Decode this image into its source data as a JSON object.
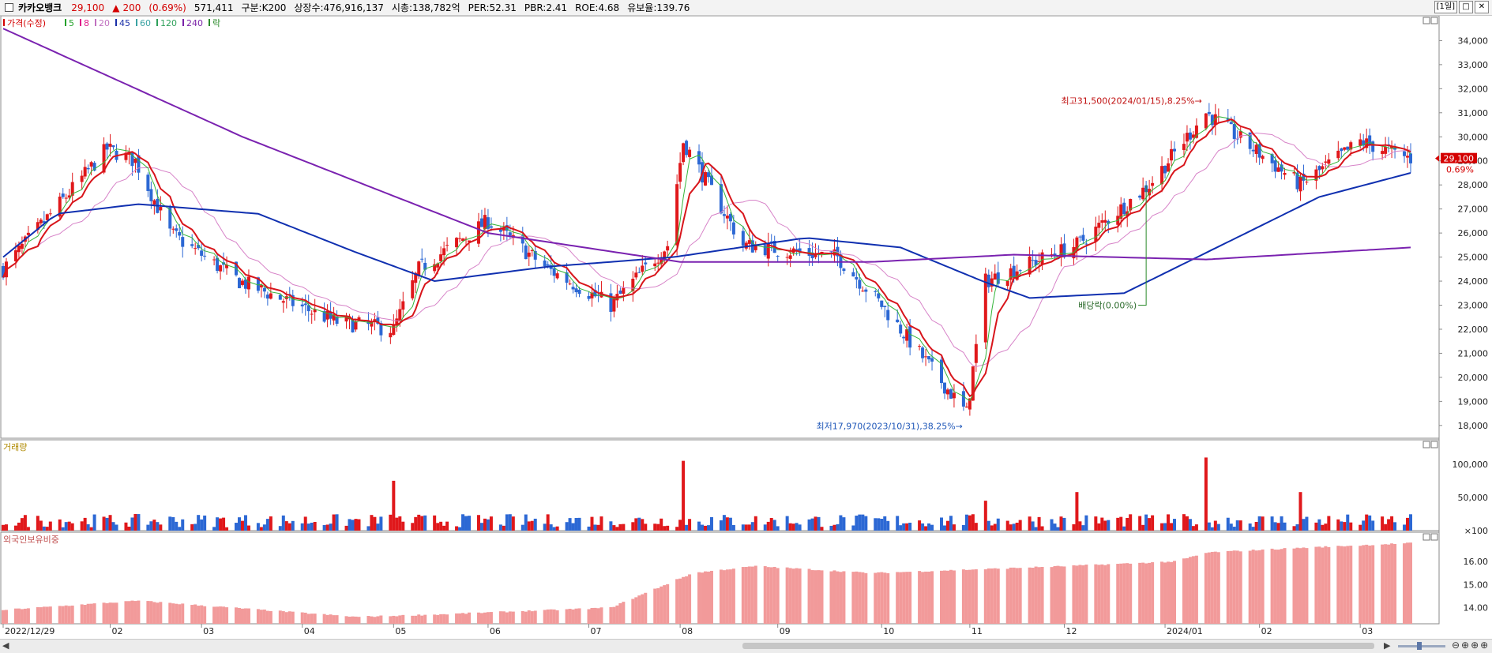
{
  "header": {
    "name": "카카오뱅크",
    "price": "29,100",
    "change_arrow": "▲",
    "change": "200",
    "change_pct": "(0.69%)",
    "volume": "571,411",
    "division": "구분:K200",
    "listed": "상장수:476,916,137",
    "market_cap": "시총:138,782억",
    "per": "PER:52.31",
    "pbr": "PBR:2.41",
    "roe": "ROE:4.68",
    "float": "유보율:139.76",
    "period_btn": "[1일]",
    "restore_btn": "□",
    "close_btn": "✕"
  },
  "legend": [
    {
      "label": "가격(수정)",
      "color": "#d40000"
    },
    {
      "label": "5",
      "color": "#24a12a"
    },
    {
      "label": "8",
      "color": "#e01b8a"
    },
    {
      "label": "20",
      "color": "#c070c0"
    },
    {
      "label": "45",
      "color": "#1a2fa8"
    },
    {
      "label": "60",
      "color": "#3aa3a3"
    },
    {
      "label": "120",
      "color": "#2ea05a"
    },
    {
      "label": "240",
      "color": "#7a22a8"
    },
    {
      "label": "락",
      "color": "#2a8a2a"
    }
  ],
  "colors": {
    "up": "#e0181b",
    "down": "#2c68d4",
    "foreign_bar": "#f29a9a",
    "ma5": "#35b53b",
    "ma8": "#d8151b",
    "ma20": "#d783c8",
    "ma45": "#1030b0",
    "ma120": "#3aa86a",
    "ma240": "#7a22b0"
  },
  "chart_data": [
    {
      "type": "candlestick",
      "title": "가격(수정)",
      "y_ticks": [
        "34,000",
        "33,000",
        "32,000",
        "31,000",
        "30,000",
        "29,000",
        "28,000",
        "27,000",
        "26,000",
        "25,000",
        "24,000",
        "23,000",
        "22,000",
        "21,000",
        "20,000",
        "19,000",
        "18,000"
      ],
      "ylim": [
        17600,
        34900
      ],
      "x_labels": [
        "2022/12/29",
        "02",
        "03",
        "04",
        "05",
        "06",
        "07",
        "08",
        "09",
        "10",
        "11",
        "12",
        "2024/01",
        "02",
        "03"
      ],
      "ohlc_anchors": [
        {
          "date": "2022/12/29",
          "close": 24500
        },
        {
          "date": "2023/01/31",
          "close": 29500
        },
        {
          "date": "2023/02/09",
          "close": 29000
        },
        {
          "date": "2023/02/20",
          "close": 26000
        },
        {
          "date": "2023/03/14",
          "close": 24000
        },
        {
          "date": "2023/04/14",
          "close": 22300
        },
        {
          "date": "2023/05/02",
          "close": 22000
        },
        {
          "date": "2023/05/10",
          "close": 24500
        },
        {
          "date": "2023/06/01",
          "close": 26500
        },
        {
          "date": "2023/06/20",
          "close": 24500
        },
        {
          "date": "2023/07/10",
          "close": 23000
        },
        {
          "date": "2023/07/28",
          "close": 25500
        },
        {
          "date": "2023/08/02",
          "close": 29800
        },
        {
          "date": "2023/08/21",
          "close": 25500
        },
        {
          "date": "2023/09/20",
          "close": 25000
        },
        {
          "date": "2023/10/04",
          "close": 23000
        },
        {
          "date": "2023/10/31",
          "close": 18500
        },
        {
          "date": "2023/11/06",
          "close": 24000
        },
        {
          "date": "2023/12/05",
          "close": 25500
        },
        {
          "date": "2023/12/28",
          "close": 28000
        },
        {
          "date": "2024/01/15",
          "close": 31000
        },
        {
          "date": "2024/02/14",
          "close": 28000
        },
        {
          "date": "2024/03/04",
          "close": 29800
        },
        {
          "date": "2024/03/20",
          "close": 29100
        }
      ],
      "annotations": [
        {
          "text": "최고31,500(2024/01/15),8.25%→",
          "date": "2024/01/15",
          "value": 31500
        },
        {
          "text": "최저17,970(2023/10/31),38.25%→",
          "date": "2023/10/31",
          "value": 17970
        },
        {
          "text": "배당락(0.00%)",
          "date": "2023/12/27",
          "value": 23000
        }
      ],
      "last_price_label": "29,100",
      "last_change_label": "0.69%",
      "moving_averages": {
        "ma240": [
          {
            "date": "2022/12/29",
            "value": 34500
          },
          {
            "date": "2023/03/15",
            "value": 30000
          },
          {
            "date": "2023/06/01",
            "value": 26000
          },
          {
            "date": "2023/08/01",
            "value": 24800
          },
          {
            "date": "2023/10/01",
            "value": 24800
          },
          {
            "date": "2023/11/15",
            "value": 25100
          },
          {
            "date": "2024/01/15",
            "value": 24900
          },
          {
            "date": "2024/03/20",
            "value": 25400
          }
        ],
        "ma45": [
          {
            "date": "2022/12/29",
            "value": 25000
          },
          {
            "date": "2023/01/15",
            "value": 26800
          },
          {
            "date": "2023/02/10",
            "value": 27200
          },
          {
            "date": "2023/03/20",
            "value": 26800
          },
          {
            "date": "2023/04/20",
            "value": 25200
          },
          {
            "date": "2023/05/15",
            "value": 24000
          },
          {
            "date": "2023/06/20",
            "value": 24600
          },
          {
            "date": "2023/07/30",
            "value": 25000
          },
          {
            "date": "2023/09/10",
            "value": 25800
          },
          {
            "date": "2023/10/10",
            "value": 25400
          },
          {
            "date": "2023/11/05",
            "value": 24000
          },
          {
            "date": "2023/11/20",
            "value": 23300
          },
          {
            "date": "2023/12/20",
            "value": 23500
          },
          {
            "date": "2024/01/20",
            "value": 25500
          },
          {
            "date": "2024/02/20",
            "value": 27500
          },
          {
            "date": "2024/03/20",
            "value": 28500
          }
        ]
      }
    },
    {
      "type": "bar",
      "title": "거래량",
      "y_ticks": [
        "100,000",
        "50,000",
        "×100"
      ],
      "peaks": [
        {
          "date": "2023/05/02",
          "value": 75000
        },
        {
          "date": "2023/08/02",
          "value": 105000
        },
        {
          "date": "2023/11/06",
          "value": 45000
        },
        {
          "date": "2023/12/05",
          "value": 58000
        },
        {
          "date": "2024/01/15",
          "value": 110000
        },
        {
          "date": "2024/02/14",
          "value": 58000
        }
      ],
      "baseline_range": [
        5000,
        25000
      ]
    },
    {
      "type": "bar",
      "title": "외국인보유비중",
      "y_ticks": [
        "16.00",
        "15.00",
        "14.00"
      ],
      "ylim": [
        13.3,
        17.0
      ],
      "anchors": [
        {
          "date": "2022/12/29",
          "value": 13.9
        },
        {
          "date": "2023/02/10",
          "value": 14.3
        },
        {
          "date": "2023/04/20",
          "value": 13.6
        },
        {
          "date": "2023/05/15",
          "value": 13.7
        },
        {
          "date": "2023/07/10",
          "value": 14.0
        },
        {
          "date": "2023/08/05",
          "value": 15.5
        },
        {
          "date": "2023/08/25",
          "value": 15.8
        },
        {
          "date": "2023/10/01",
          "value": 15.5
        },
        {
          "date": "2023/12/01",
          "value": 15.8
        },
        {
          "date": "2024/01/05",
          "value": 16.0
        },
        {
          "date": "2024/01/16",
          "value": 16.4
        },
        {
          "date": "2024/02/15",
          "value": 16.6
        },
        {
          "date": "2024/03/20",
          "value": 16.8
        }
      ]
    }
  ]
}
